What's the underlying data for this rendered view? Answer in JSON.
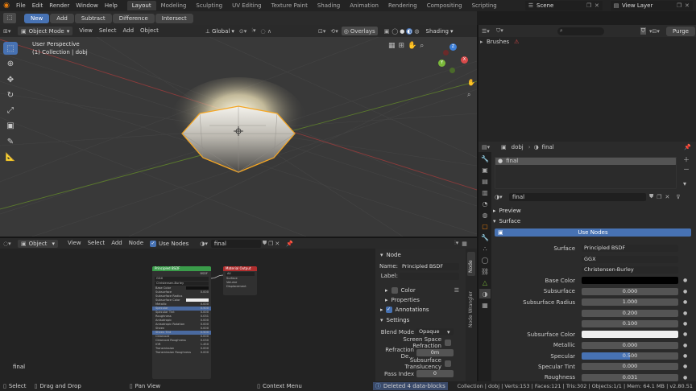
{
  "topbar": {
    "menus": [
      "File",
      "Edit",
      "Render",
      "Window",
      "Help"
    ],
    "workspaces": [
      "Layout",
      "Modeling",
      "Sculpting",
      "UV Editing",
      "Texture Paint",
      "Shading",
      "Animation",
      "Rendering",
      "Compositing",
      "Scripting"
    ],
    "active_workspace": "Layout",
    "scene": "Scene",
    "view_layer": "View Layer"
  },
  "selbar": {
    "modes": [
      "New",
      "Add",
      "Subtract",
      "Difference",
      "Intersect"
    ]
  },
  "viewport_header": {
    "mode": "Object Mode",
    "menus": [
      "View",
      "Select",
      "Add",
      "Object"
    ],
    "transform": "Global",
    "overlays": "Overlays",
    "shading": "Shading"
  },
  "viewport": {
    "title": "User Perspective",
    "subtitle": "(1) Collection | dobj"
  },
  "gizmo": {
    "x": "X",
    "y": "Y",
    "z": "Z"
  },
  "outliner": {
    "item": "Brushes",
    "purge": "Purge"
  },
  "props_header": {
    "object": "dobj",
    "material": "final"
  },
  "material_slot": "final",
  "material_name": "final",
  "sections": {
    "preview": "Preview",
    "surface": "Surface"
  },
  "use_nodes": "Use Nodes",
  "surface_rows": [
    {
      "label": "Surface",
      "value": "Principled BSDF",
      "kind": "drop"
    },
    {
      "label": "",
      "value": "GGX",
      "kind": "drop"
    },
    {
      "label": "",
      "value": "Christensen-Burley",
      "kind": "drop"
    },
    {
      "label": "Base Color",
      "value": "",
      "kind": "color-black"
    },
    {
      "label": "Subsurface",
      "value": "0.000",
      "kind": "num"
    },
    {
      "label": "Subsurface Radius",
      "value": "1.000",
      "kind": "num"
    },
    {
      "label": "",
      "value": "0.200",
      "kind": "num"
    },
    {
      "label": "",
      "value": "0.100",
      "kind": "num"
    },
    {
      "label": "Subsurface Color",
      "value": "",
      "kind": "color-white"
    },
    {
      "label": "Metallic",
      "value": "0.000",
      "kind": "num"
    },
    {
      "label": "Specular",
      "value": "0.500",
      "kind": "slider",
      "fill": 0.5
    },
    {
      "label": "Specular Tint",
      "value": "0.000",
      "kind": "num"
    },
    {
      "label": "Roughness",
      "value": "0.031",
      "kind": "num"
    }
  ],
  "node_header": {
    "mode": "Object",
    "menus": [
      "View",
      "Select",
      "Add",
      "Node"
    ],
    "use_nodes": "Use Nodes",
    "material": "final"
  },
  "node_editor": {
    "material_label": "final"
  },
  "bsdf_node": {
    "title": "Principled BSDF",
    "output": "BSDF",
    "dropdowns": [
      "GGX",
      "Christensen-Burley"
    ],
    "inputs": [
      {
        "name": "Base Color",
        "value": ""
      },
      {
        "name": "Subsurface",
        "value": "0.000"
      },
      {
        "name": "Subsurface Radius",
        "value": ""
      },
      {
        "name": "Subsurface Color",
        "value": ""
      },
      {
        "name": "Metallic",
        "value": "0.000"
      },
      {
        "name": "Specular",
        "value": "0.500"
      },
      {
        "name": "Specular Tint",
        "value": "0.000"
      },
      {
        "name": "Roughness",
        "value": "0.031"
      },
      {
        "name": "Anisotropic",
        "value": "0.000"
      },
      {
        "name": "Anisotropic Rotation",
        "value": "0.000"
      },
      {
        "name": "Sheen",
        "value": "0.000"
      },
      {
        "name": "Sheen Tint",
        "value": "0.500"
      },
      {
        "name": "Clearcoat",
        "value": "0.000"
      },
      {
        "name": "Clearcoat Roughness",
        "value": "0.030"
      },
      {
        "name": "IOR",
        "value": "1.450"
      },
      {
        "name": "Transmission",
        "value": "0.000"
      },
      {
        "name": "Transmission Roughness",
        "value": "0.000"
      }
    ]
  },
  "output_node": {
    "title": "Material Output",
    "target": "All",
    "inputs": [
      "Surface",
      "Volume",
      "Displacement"
    ]
  },
  "node_panel": {
    "section": "Node",
    "name_label": "Name:",
    "name_value": "Principled BSDF",
    "label_label": "Label:",
    "color": "Color",
    "properties": "Properties",
    "annotations": "Annotations",
    "settings": "Settings",
    "blend_mode_label": "Blend Mode",
    "blend_mode": "Opaque",
    "ssr": "Screen Space Refraction",
    "refraction_label": "Refraction De...",
    "refraction_value": "0m",
    "sst": "Subsurface Translucency",
    "pass_label": "Pass Index",
    "pass_value": "0"
  },
  "side_tabs": {
    "node": "Node",
    "wrangler": "Node Wrangler"
  },
  "statusbar": {
    "select": "Select",
    "drag": "Drag and Drop",
    "pan": "Pan View",
    "context": "Context Menu",
    "message": "Deleted 4 data-blocks",
    "stats": "Collection | dobj | Verts:153 | Faces:121 | Tris:302 | Objects:1/1 | Mem: 64.1 MB | v2.80.51"
  },
  "colors": {
    "accent": "#4772b3",
    "selection": "#f5a623",
    "viewport_bg": "#393939"
  }
}
